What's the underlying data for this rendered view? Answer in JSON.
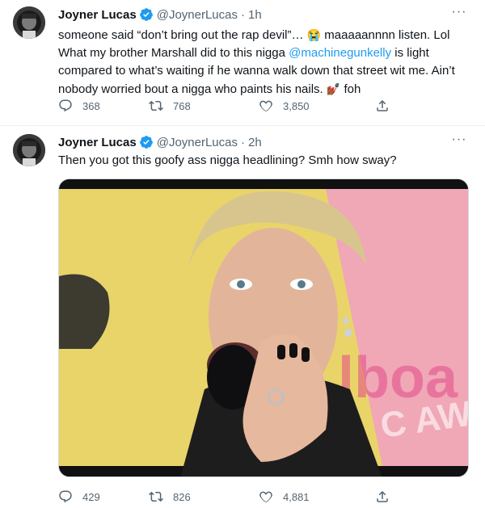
{
  "tweets": [
    {
      "author": {
        "name": "Joyner Lucas",
        "handle": "@JoynerLucas"
      },
      "time": "1h",
      "text_parts": {
        "p1": "someone said “don’t bring out the rap devil”…",
        "emoji1": "😭",
        "p2": "maaaaannnn listen. Lol What my brother Marshall did to this nigga",
        "mention": "@machinegunkelly",
        "p3": "is light compared to what’s waiting if he wanna walk down that street wit me. Ain’t nobody worried bout a nigga who paints his nails.",
        "emoji2": "💅🏾",
        "p4": "foh"
      },
      "stats": {
        "replies": "368",
        "retweets": "768",
        "likes": "3,850"
      }
    },
    {
      "author": {
        "name": "Joyner Lucas",
        "handle": "@JoynerLucas"
      },
      "time": "2h",
      "text": "Then you got this goofy ass nigga headlining? Smh how sway?",
      "media": {
        "watermark": "lboa",
        "sub": "C AWA"
      },
      "stats": {
        "replies": "429",
        "retweets": "826",
        "likes": "4,881"
      }
    }
  ],
  "ui": {
    "separator": "·",
    "more": "···",
    "verified_color": "#1d9bf0",
    "accent": "#1d9bf0"
  }
}
